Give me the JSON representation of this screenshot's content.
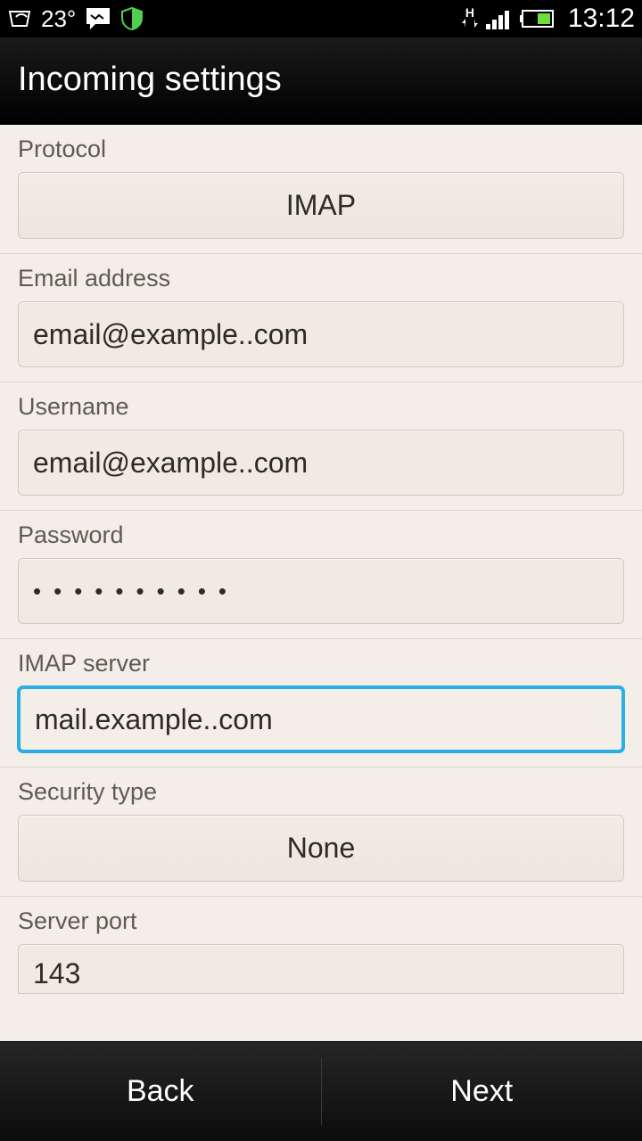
{
  "status": {
    "temperature": "23°",
    "time": "13:12",
    "network_indicator": "H"
  },
  "header": {
    "title": "Incoming settings"
  },
  "form": {
    "protocol": {
      "label": "Protocol",
      "value": "IMAP"
    },
    "email": {
      "label": "Email address",
      "value": "email@example..com"
    },
    "username": {
      "label": "Username",
      "value": "email@example..com"
    },
    "password": {
      "label": "Password",
      "masked": "••••••••••"
    },
    "imap_server": {
      "label": "IMAP server",
      "value": "mail.example..com"
    },
    "security_type": {
      "label": "Security type",
      "value": "None"
    },
    "server_port": {
      "label": "Server port",
      "value": "143"
    }
  },
  "footer": {
    "back": "Back",
    "next": "Next"
  }
}
